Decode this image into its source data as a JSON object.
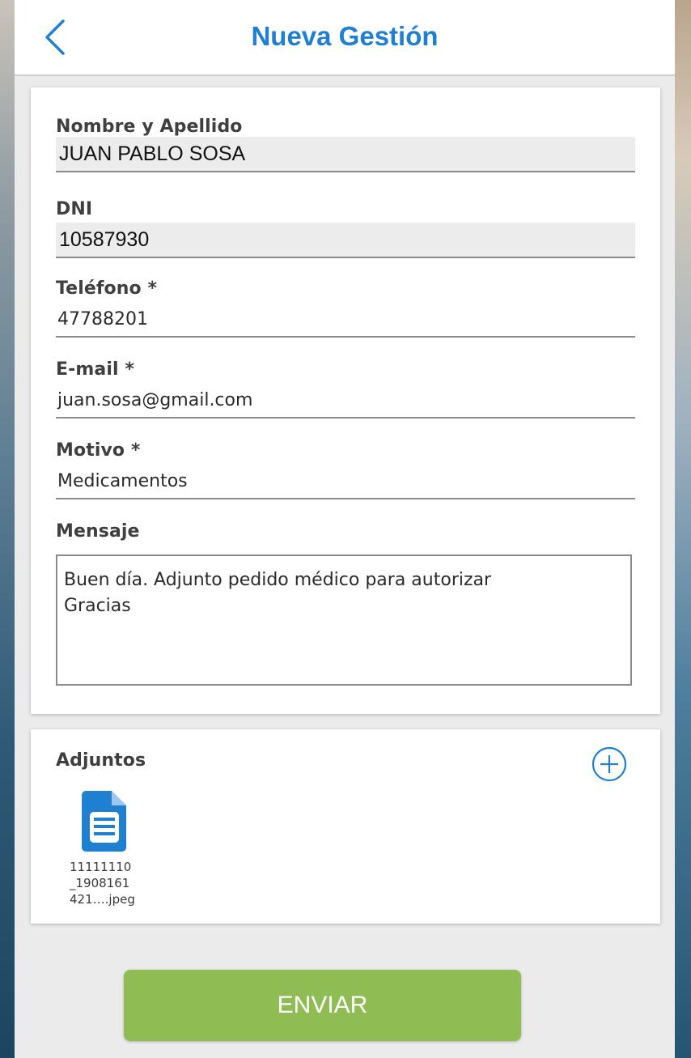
{
  "header": {
    "title": "Nueva Gestión"
  },
  "form": {
    "nombre": {
      "label": "Nombre y Apellido",
      "value": "JUAN PABLO SOSA"
    },
    "dni": {
      "label": "DNI",
      "value": "10587930"
    },
    "telefono": {
      "label": "Teléfono *",
      "value": "47788201"
    },
    "email": {
      "label": "E-mail *",
      "value": "juan.sosa@gmail.com"
    },
    "motivo": {
      "label": "Motivo *",
      "value": "Medicamentos"
    },
    "mensaje": {
      "label": "Mensaje",
      "value": "Buen día. Adjunto pedido médico para autorizar\nGracias"
    }
  },
  "adjuntos": {
    "title": "Adjuntos",
    "files": [
      {
        "name_line1": "11111110",
        "name_line2": "_1908161",
        "name_line3": "421….jpeg"
      }
    ]
  },
  "actions": {
    "send_label": "ENVIAR"
  },
  "colors": {
    "accent": "#1f7fd1",
    "send": "#8fbd54"
  },
  "icons": {
    "back": "chevron-left-icon",
    "add": "plus-circle-icon",
    "file": "document-icon"
  }
}
